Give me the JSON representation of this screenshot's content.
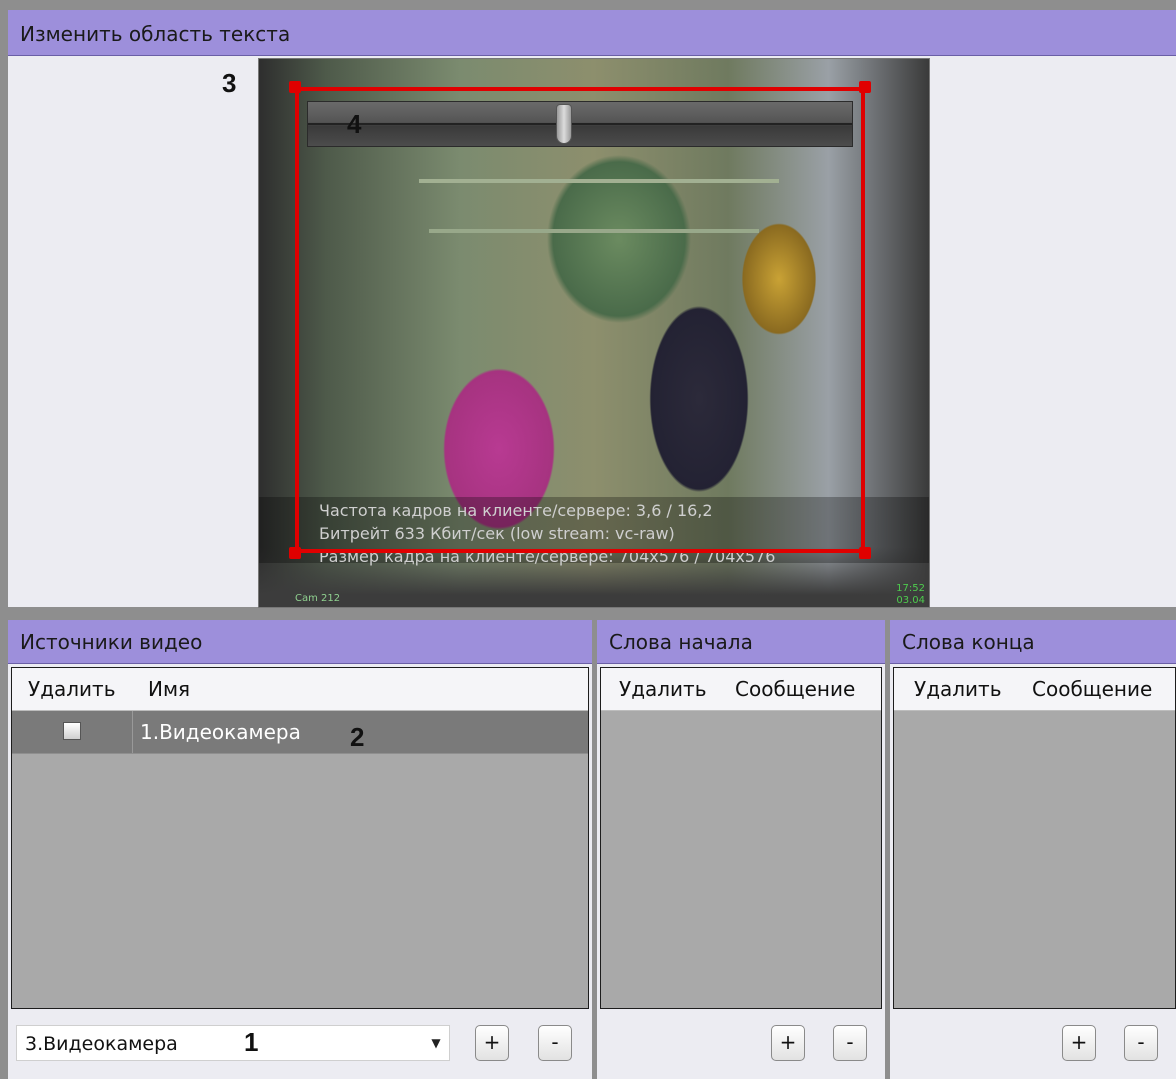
{
  "editor": {
    "title": "Изменить область текста",
    "callout_region": "3",
    "callout_slider": "4",
    "osd": {
      "line1": "Частота кадров на клиенте/сервере: 3,6 / 16,2",
      "line2": "Битрейт 633 Кбит/сек (low stream: vc-raw)",
      "line3": "Размер кадра на клиенте/сервере: 704x576 / 704x576"
    },
    "timestamp_top": "17:52",
    "timestamp_bottom": "03.04",
    "camera_label": "Cam 212",
    "slider_value_fraction": 0.47
  },
  "sources": {
    "title": "Источники видео",
    "col_delete": "Удалить",
    "col_name": "Имя",
    "rows": [
      {
        "name": "1.Видеокамера",
        "checked": false
      }
    ],
    "callout_row": "2",
    "combo_value": "3.Видеокамера",
    "callout_combo": "1",
    "add_label": "+",
    "remove_label": "-"
  },
  "start_words": {
    "title": "Слова начала",
    "col_delete": "Удалить",
    "col_message": "Сообщение",
    "add_label": "+",
    "remove_label": "-"
  },
  "end_words": {
    "title": "Слова конца",
    "col_delete": "Удалить",
    "col_message": "Сообщение",
    "add_label": "+",
    "remove_label": "-"
  },
  "colors": {
    "header_bg": "#9d8fdb",
    "selection_rect": "#e00000",
    "grid_bg": "#a9a9a9",
    "selected_row": "#7a7a7a"
  }
}
